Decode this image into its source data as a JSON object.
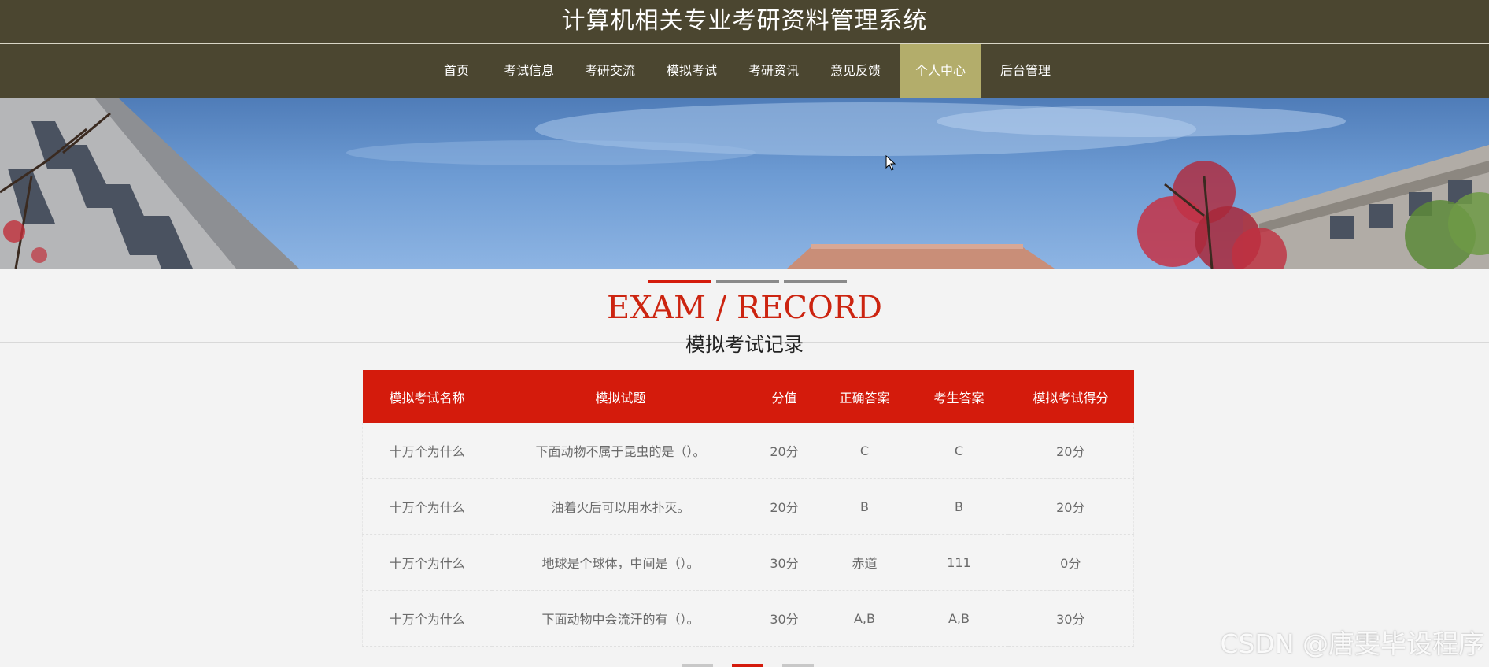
{
  "header": {
    "title": "计算机相关专业考研资料管理系统"
  },
  "nav": {
    "items": [
      {
        "label": "首页"
      },
      {
        "label": "考试信息"
      },
      {
        "label": "考研交流"
      },
      {
        "label": "模拟考试"
      },
      {
        "label": "考研资讯"
      },
      {
        "label": "意见反馈"
      },
      {
        "label": "个人中心",
        "active": true
      },
      {
        "label": "后台管理"
      }
    ]
  },
  "section": {
    "title_en": "EXAM / RECORD",
    "title_cn": "模拟考试记录"
  },
  "table": {
    "columns": [
      "模拟考试名称",
      "模拟试题",
      "分值",
      "正确答案",
      "考生答案",
      "模拟考试得分"
    ],
    "rows": [
      [
        "十万个为什么",
        "下面动物不属于昆虫的是（）。",
        "20分",
        "C",
        "C",
        "20分"
      ],
      [
        "十万个为什么",
        "油着火后可以用水扑灭。",
        "20分",
        "B",
        "B",
        "20分"
      ],
      [
        "十万个为什么",
        "地球是个球体，中间是（）。",
        "30分",
        "赤道",
        "111",
        "0分"
      ],
      [
        "十万个为什么",
        "下面动物中会流汗的有（）。",
        "30分",
        "A,B",
        "A,B",
        "30分"
      ]
    ]
  },
  "watermark": {
    "text": "CSDN @唐雯毕设程序"
  },
  "colors": {
    "header_bg": "#4b4630",
    "nav_active": "#b3ad6b",
    "accent_red": "#d41b0c",
    "title_red": "#cc2410"
  }
}
